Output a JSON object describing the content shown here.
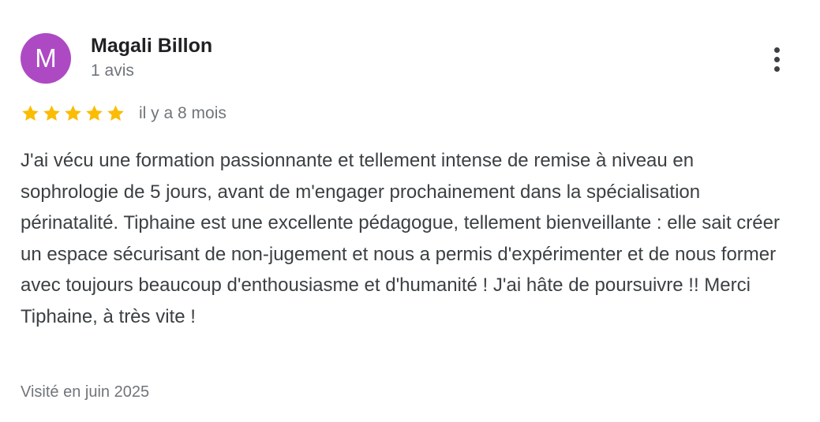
{
  "review": {
    "author": {
      "initial": "M",
      "name": "Magali Billon",
      "review_count": "1 avis",
      "avatar_color": "#ad4ac3"
    },
    "menu_icon": "more-vertical-icon",
    "rating": {
      "stars": 5,
      "max": 5,
      "star_color": "#fbbc04",
      "star_icon": "star-icon"
    },
    "relative_time": "il y a 8 mois",
    "text": "J'ai vécu une formation passionnante et tellement intense de remise à niveau en sophrologie de 5 jours, avant de m'engager prochainement dans la spécialisation périnatalité. Tiphaine est une excellente pédagogue, tellement bienveillante : elle sait créer un espace sécurisant de non-jugement et nous a permis d'expérimenter et de nous former avec toujours beaucoup d'enthousiasme et d'humanité ! J'ai hâte de poursuivre !! Merci Tiphaine, à très vite !",
    "visited": "Visité en juin 2025"
  }
}
